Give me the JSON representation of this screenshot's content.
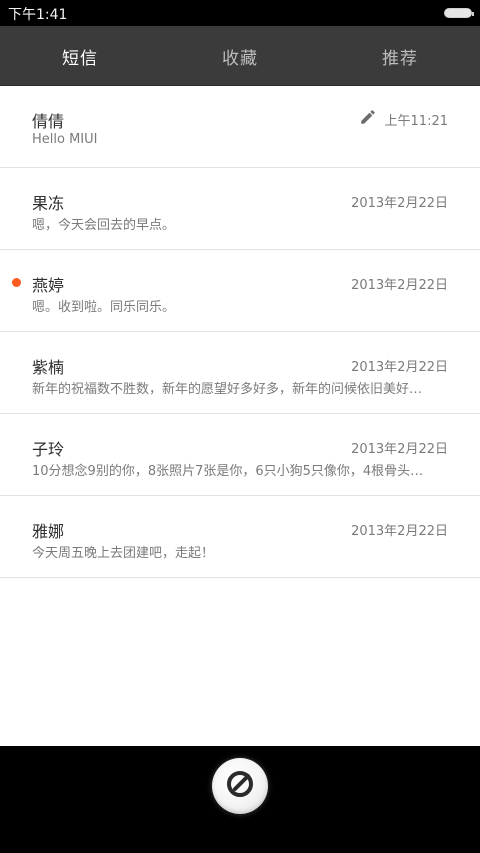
{
  "status_bar": {
    "time": "下午1:41",
    "battery_icon": "battery-icon"
  },
  "tabs": [
    {
      "label": "短信",
      "active": true
    },
    {
      "label": "收藏",
      "active": false
    },
    {
      "label": "推荐",
      "active": false
    }
  ],
  "messages": [
    {
      "name": "倩倩",
      "preview": "Hello MIUI",
      "date": "上午11:21",
      "draft": true,
      "unread": false
    },
    {
      "name": "果冻",
      "preview": "嗯，今天会回去的早点。",
      "date": "2013年2月22日",
      "draft": false,
      "unread": false
    },
    {
      "name": "燕婷",
      "preview": "嗯。收到啦。同乐同乐。",
      "date": "2013年2月22日",
      "draft": false,
      "unread": true
    },
    {
      "name": "紫楠",
      "preview": "新年的祝福数不胜数，新年的愿望好多好多，新年的问候依旧美好…",
      "date": "2013年2月22日",
      "draft": false,
      "unread": false
    },
    {
      "name": "子玲",
      "preview": "10分想念9别的你，8张照片7张是你，6只小狗5只像你，4根骨头…",
      "date": "2013年2月22日",
      "draft": false,
      "unread": false
    },
    {
      "name": "雅娜",
      "preview": "今天周五晚上去团建吧，走起！",
      "date": "2013年2月22日",
      "draft": false,
      "unread": false
    }
  ],
  "colors": {
    "unread_dot": "#ff5a1f",
    "tab_bar": "#3b3b3b",
    "background": "#ffffff"
  },
  "compose": {
    "icon": "compose-icon"
  }
}
